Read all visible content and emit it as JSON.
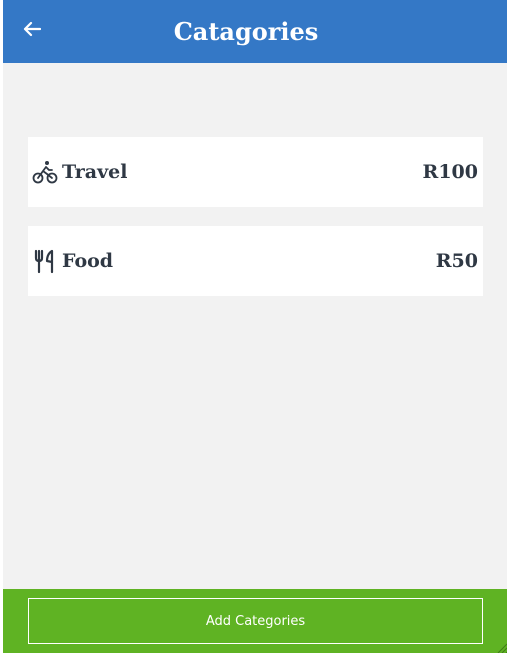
{
  "header": {
    "title": "Catagories",
    "back_icon": "arrow-left-icon"
  },
  "categories": [
    {
      "icon": "bicycle-icon",
      "name": "Travel",
      "amount": "R100"
    },
    {
      "icon": "utensils-icon",
      "name": "Food",
      "amount": "R50"
    }
  ],
  "footer": {
    "add_label": "Add Categories"
  },
  "colors": {
    "header": "#3478c6",
    "footer": "#5fb323",
    "background": "#f2f2f2",
    "card": "#ffffff",
    "text": "#2f3844"
  }
}
